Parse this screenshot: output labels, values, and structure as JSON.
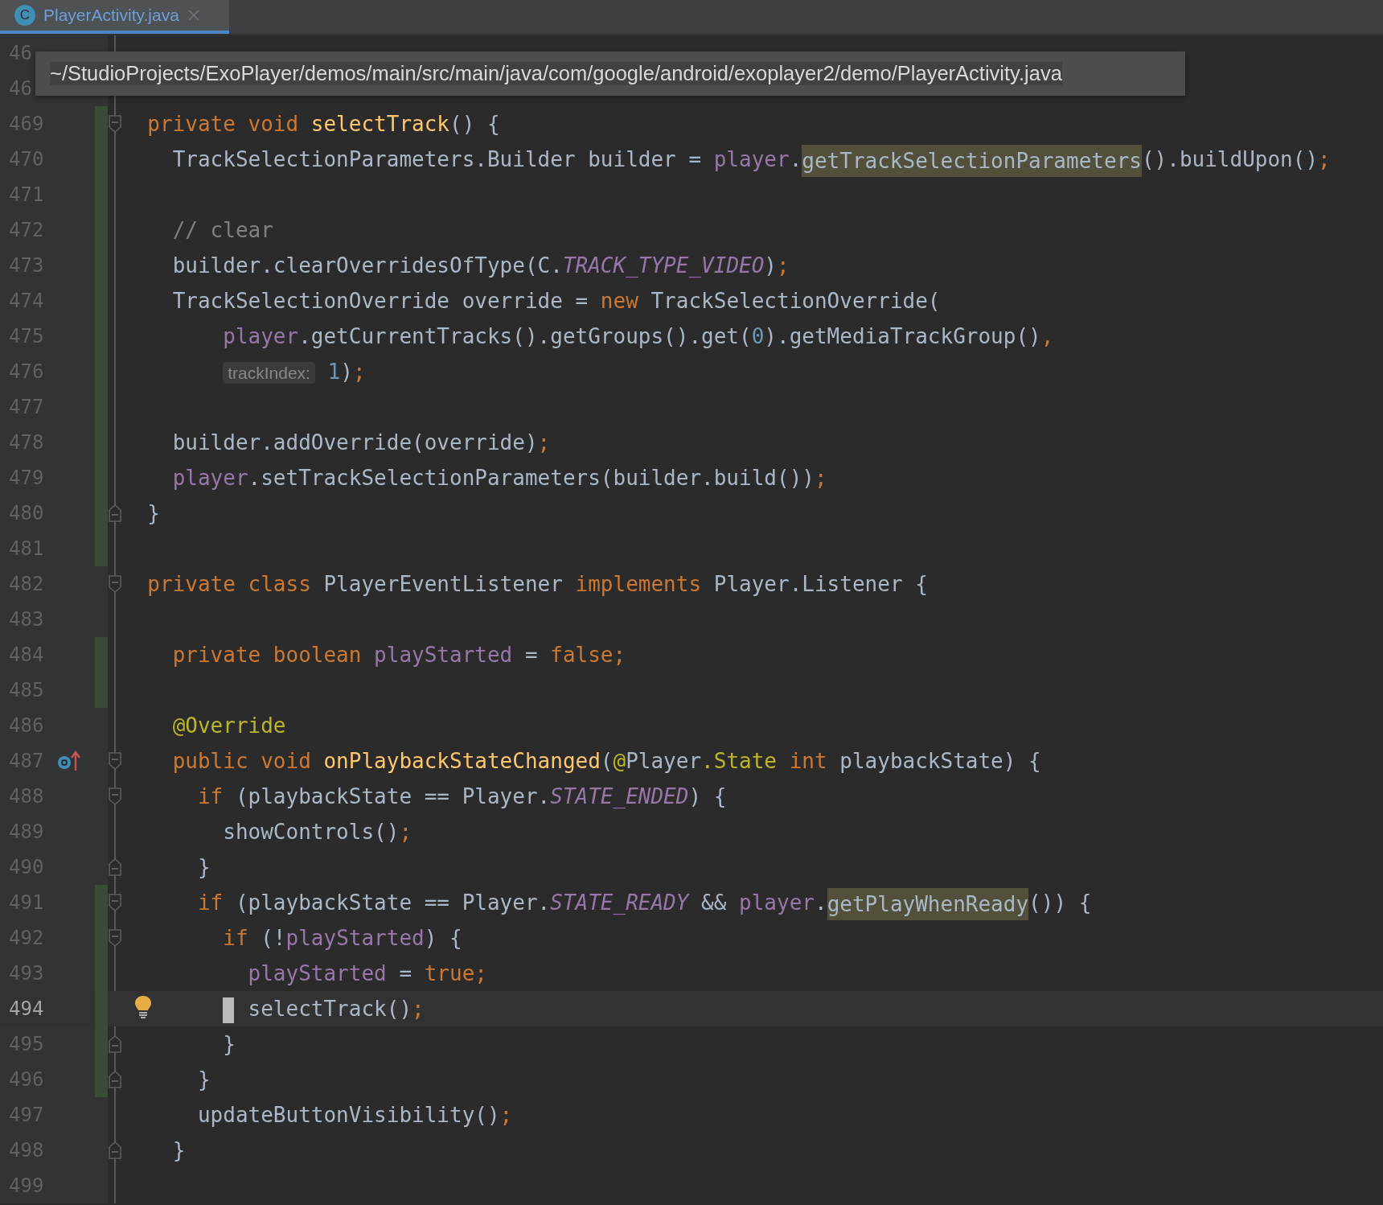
{
  "tab": {
    "icon_letter": "C",
    "label": "PlayerActivity.java",
    "selected": true
  },
  "tooltip": {
    "path": "~/StudioProjects/ExoPlayer/demos/main/src/main/java/com/google/android/exoplayer2/demo/PlayerActivity.java"
  },
  "lines": [
    {
      "number": "46",
      "current": false,
      "changed": false
    },
    {
      "number": "46",
      "current": false,
      "changed": false
    },
    {
      "number": "469",
      "current": false,
      "changed": true,
      "gutter": [
        {
          "kind": "fold-start"
        }
      ],
      "tokens": [
        {
          "kind": "keyword",
          "text": "  private void "
        },
        {
          "kind": "declaration",
          "text": "selectTrack"
        },
        {
          "kind": "plain",
          "text": "() {"
        }
      ]
    },
    {
      "number": "470",
      "current": false,
      "changed": true,
      "tokens": [
        {
          "kind": "plain",
          "text": "    TrackSelectionParameters.Builder builder = "
        },
        {
          "kind": "field",
          "text": "player"
        },
        {
          "kind": "plain",
          "text": "."
        },
        {
          "kind": "match",
          "text": "getTrackSelectionParameters"
        },
        {
          "kind": "plain",
          "text": "().buildUpon()"
        },
        {
          "kind": "keyword",
          "text": ";"
        }
      ]
    },
    {
      "number": "471",
      "current": false,
      "changed": true
    },
    {
      "number": "472",
      "current": false,
      "changed": true,
      "tokens": [
        {
          "kind": "comment",
          "text": "    // clear"
        }
      ]
    },
    {
      "number": "473",
      "current": false,
      "changed": true,
      "tokens": [
        {
          "kind": "plain",
          "text": "    builder.clearOverridesOfType(C."
        },
        {
          "kind": "constant",
          "text": "TRACK_TYPE_VIDEO"
        },
        {
          "kind": "plain",
          "text": ")"
        },
        {
          "kind": "keyword",
          "text": ";"
        }
      ]
    },
    {
      "number": "474",
      "current": false,
      "changed": true,
      "tokens": [
        {
          "kind": "plain",
          "text": "    TrackSelectionOverride override = "
        },
        {
          "kind": "keyword",
          "text": "new "
        },
        {
          "kind": "plain",
          "text": "TrackSelectionOverride("
        }
      ]
    },
    {
      "number": "475",
      "current": false,
      "changed": true,
      "tokens": [
        {
          "kind": "field",
          "text": "        player"
        },
        {
          "kind": "plain",
          "text": ".getCurrentTracks().getGroups().get("
        },
        {
          "kind": "number",
          "text": "0"
        },
        {
          "kind": "plain",
          "text": ").getMediaTrackGroup()"
        },
        {
          "kind": "keyword",
          "text": ","
        }
      ]
    },
    {
      "number": "476",
      "current": false,
      "changed": true,
      "tokens": [
        {
          "kind": "hint",
          "text": "        trackIndex:"
        },
        {
          "kind": "number",
          "text": " 1"
        },
        {
          "kind": "plain",
          "text": ")"
        },
        {
          "kind": "keyword",
          "text": ";"
        }
      ]
    },
    {
      "number": "477",
      "current": false,
      "changed": true
    },
    {
      "number": "478",
      "current": false,
      "changed": true,
      "tokens": [
        {
          "kind": "plain",
          "text": "    builder.addOverride(override)"
        },
        {
          "kind": "keyword",
          "text": ";"
        }
      ]
    },
    {
      "number": "479",
      "current": false,
      "changed": true,
      "tokens": [
        {
          "kind": "field",
          "text": "    player"
        },
        {
          "kind": "plain",
          "text": ".setTrackSelectionParameters(builder.build())"
        },
        {
          "kind": "keyword",
          "text": ";"
        }
      ]
    },
    {
      "number": "480",
      "current": false,
      "changed": true,
      "gutter": [
        {
          "kind": "fold-end"
        }
      ],
      "tokens": [
        {
          "kind": "plain",
          "text": "  }"
        }
      ]
    },
    {
      "number": "481",
      "current": false,
      "changed": true
    },
    {
      "number": "482",
      "current": false,
      "changed": false,
      "gutter": [
        {
          "kind": "fold-start"
        }
      ],
      "tokens": [
        {
          "kind": "keyword",
          "text": "  private class "
        },
        {
          "kind": "plain",
          "text": "PlayerEventListener "
        },
        {
          "kind": "keyword",
          "text": "implements "
        },
        {
          "kind": "plain",
          "text": "Player.Listener {"
        }
      ]
    },
    {
      "number": "483",
      "current": false,
      "changed": false
    },
    {
      "number": "484",
      "current": false,
      "changed": true,
      "tokens": [
        {
          "kind": "keyword",
          "text": "    private boolean "
        },
        {
          "kind": "field",
          "text": "playStarted"
        },
        {
          "kind": "plain",
          "text": " = "
        },
        {
          "kind": "keyword",
          "text": "false;"
        }
      ]
    },
    {
      "number": "485",
      "current": false,
      "changed": true
    },
    {
      "number": "486",
      "current": false,
      "changed": false,
      "tokens": [
        {
          "kind": "annotation",
          "text": "    @Override"
        }
      ]
    },
    {
      "number": "487",
      "current": false,
      "changed": false,
      "gutter": [
        {
          "kind": "override"
        },
        {
          "kind": "fold-start"
        }
      ],
      "tokens": [
        {
          "kind": "keyword",
          "text": "    public void "
        },
        {
          "kind": "declaration",
          "text": "onPlaybackStateChanged"
        },
        {
          "kind": "plain",
          "text": "("
        },
        {
          "kind": "annotation",
          "text": "@"
        },
        {
          "kind": "plain",
          "text": "Player"
        },
        {
          "kind": "annotation",
          "text": ".State"
        },
        {
          "kind": "keyword",
          "text": " int "
        },
        {
          "kind": "plain",
          "text": "playbackState) {"
        }
      ]
    },
    {
      "number": "488",
      "current": false,
      "changed": false,
      "gutter": [
        {
          "kind": "fold-start"
        }
      ],
      "tokens": [
        {
          "kind": "keyword",
          "text": "      if "
        },
        {
          "kind": "plain",
          "text": "(playbackState == Player."
        },
        {
          "kind": "constant",
          "text": "STATE_ENDED"
        },
        {
          "kind": "plain",
          "text": ") {"
        }
      ]
    },
    {
      "number": "489",
      "current": false,
      "changed": false,
      "tokens": [
        {
          "kind": "plain",
          "text": "        showControls()"
        },
        {
          "kind": "keyword",
          "text": ";"
        }
      ]
    },
    {
      "number": "490",
      "current": false,
      "changed": false,
      "gutter": [
        {
          "kind": "fold-end"
        }
      ],
      "tokens": [
        {
          "kind": "plain",
          "text": "      }"
        }
      ]
    },
    {
      "number": "491",
      "current": false,
      "changed": true,
      "gutter": [
        {
          "kind": "fold-start"
        }
      ],
      "tokens": [
        {
          "kind": "keyword",
          "text": "      if "
        },
        {
          "kind": "plain",
          "text": "(playbackState == Player."
        },
        {
          "kind": "constant",
          "text": "STATE_READY"
        },
        {
          "kind": "plain",
          "text": " && "
        },
        {
          "kind": "field",
          "text": "player"
        },
        {
          "kind": "plain",
          "text": "."
        },
        {
          "kind": "match",
          "text": "getPlayWhenReady"
        },
        {
          "kind": "plain",
          "text": "()) {"
        }
      ]
    },
    {
      "number": "492",
      "current": false,
      "changed": true,
      "gutter": [
        {
          "kind": "fold-start"
        }
      ],
      "tokens": [
        {
          "kind": "keyword",
          "text": "        if "
        },
        {
          "kind": "plain",
          "text": "(!"
        },
        {
          "kind": "field",
          "text": "playStarted"
        },
        {
          "kind": "plain",
          "text": ") {"
        }
      ]
    },
    {
      "number": "493",
      "current": false,
      "changed": true,
      "tokens": [
        {
          "kind": "field",
          "text": "          playStarted"
        },
        {
          "kind": "plain",
          "text": " = "
        },
        {
          "kind": "keyword",
          "text": "true;"
        }
      ]
    },
    {
      "number": "494",
      "current": true,
      "changed": true,
      "caret": true,
      "gutter": [
        {
          "kind": "bulb"
        }
      ],
      "tokens": [
        {
          "kind": "plain",
          "text": "          selectTrack()"
        },
        {
          "kind": "keyword",
          "text": ";"
        }
      ]
    },
    {
      "number": "495",
      "current": false,
      "changed": true,
      "gutter": [
        {
          "kind": "fold-end"
        }
      ],
      "tokens": [
        {
          "kind": "plain",
          "text": "        }"
        }
      ]
    },
    {
      "number": "496",
      "current": false,
      "changed": true,
      "gutter": [
        {
          "kind": "fold-end"
        }
      ],
      "tokens": [
        {
          "kind": "plain",
          "text": "      }"
        }
      ]
    },
    {
      "number": "497",
      "current": false,
      "changed": false,
      "tokens": [
        {
          "kind": "plain",
          "text": "      updateButtonVisibility()"
        },
        {
          "kind": "keyword",
          "text": ";"
        }
      ]
    },
    {
      "number": "498",
      "current": false,
      "changed": false,
      "gutter": [
        {
          "kind": "fold-end"
        }
      ],
      "tokens": [
        {
          "kind": "plain",
          "text": "    }"
        }
      ]
    },
    {
      "number": "499",
      "current": false,
      "changed": false
    }
  ]
}
